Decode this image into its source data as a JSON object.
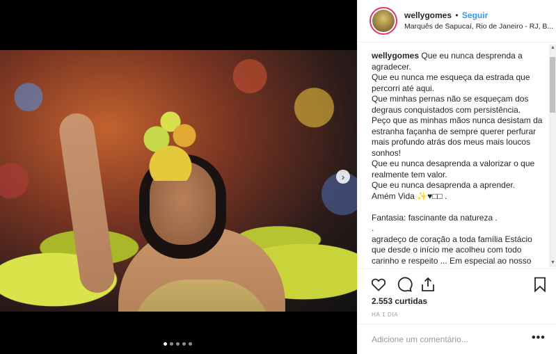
{
  "post": {
    "username": "wellygomes",
    "separator": "•",
    "follow_label": "Seguir",
    "location": "Marquês de Sapucaí, Rio de Janeiro - RJ, B...",
    "caption": {
      "username": "wellygomes",
      "lines": [
        "Que eu nunca desprenda a agradecer.",
        "Que eu nunca me esqueça da estrada que percorri até aqui.",
        "Que minhas pernas não se esqueçam dos degraus conquistados com persistência.",
        "Peço que as minhas mãos nunca desistam da estranha façanha de sempre querer perfurar mais profundo atrás dos meus mais loucos sonhos!",
        "Que eu nunca desaprenda a valorizar o que realmente tem valor.",
        "Que eu nunca desaprenda a aprender.",
        "Amém Vida ✨♥□□ .",
        "",
        "Fantasia: fascinante da natureza .",
        ".",
        "agradeço de coração a toda família Estácio que desde o início me acolheu com todo carinho e respeito ... Em especial ao nosso"
      ]
    },
    "likes": "2.553 curtidas",
    "time": "HÁ 1 DIA",
    "comment_placeholder": "Adicione um comentário...",
    "more_label": "•••",
    "next_label": "›",
    "carousel": {
      "count": 5,
      "active": 0
    }
  }
}
